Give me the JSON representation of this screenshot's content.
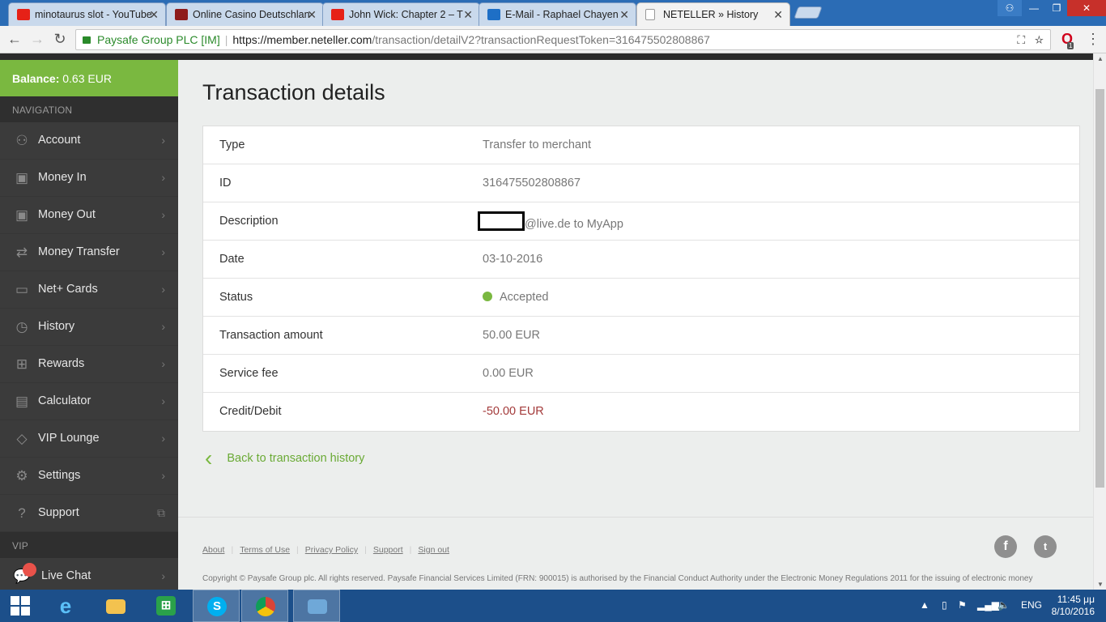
{
  "browser": {
    "tabs": [
      {
        "label": "minotaurus slot - YouTube",
        "favicon": "youtube-icon",
        "color": "#e62117"
      },
      {
        "label": "Online Casino Deutschland",
        "favicon": "casino-d-icon",
        "color": "#8e1b1b"
      },
      {
        "label": "John Wick: Chapter 2 – T",
        "favicon": "youtube-icon",
        "color": "#e62117"
      },
      {
        "label": "E-Mail - Raphael Chayen",
        "favicon": "outlook-icon",
        "color": "#1e6fc6"
      },
      {
        "label": "NETELLER » History",
        "favicon": "page-icon",
        "color": "#ffffff"
      }
    ],
    "secure_label": "Paysafe Group PLC [IM]",
    "url_host": "https://member.neteller.com",
    "url_path": "/transaction/detailV2?transactionRequestToken=316475502808867",
    "extension_badge": "1"
  },
  "sidebar": {
    "balance_label": "Balance:",
    "balance_value": "0.63 EUR",
    "navigation_heading": "NAVIGATION",
    "items": [
      {
        "label": "Account",
        "icon": "user-icon"
      },
      {
        "label": "Money In",
        "icon": "money-in-icon"
      },
      {
        "label": "Money Out",
        "icon": "money-out-icon"
      },
      {
        "label": "Money Transfer",
        "icon": "transfer-icon"
      },
      {
        "label": "Net+ Cards",
        "icon": "card-icon"
      },
      {
        "label": "History",
        "icon": "clock-icon"
      },
      {
        "label": "Rewards",
        "icon": "gift-icon"
      },
      {
        "label": "Calculator",
        "icon": "calculator-icon"
      },
      {
        "label": "VIP Lounge",
        "icon": "diamond-icon"
      },
      {
        "label": "Settings",
        "icon": "gear-icon"
      },
      {
        "label": "Support",
        "icon": "help-icon"
      }
    ],
    "vip_heading": "VIP",
    "live_chat": "Live Chat"
  },
  "main": {
    "title": "Transaction details",
    "rows": [
      {
        "key": "Type",
        "value": "Transfer to merchant"
      },
      {
        "key": "ID",
        "value": "316475502808867"
      },
      {
        "key": "Description",
        "value": "@live.de to MyApp"
      },
      {
        "key": "Date",
        "value": "03-10-2016"
      },
      {
        "key": "Status",
        "value": "Accepted"
      },
      {
        "key": "Transaction amount",
        "value": "50.00 EUR"
      },
      {
        "key": "Service fee",
        "value": "0.00 EUR"
      },
      {
        "key": "Credit/Debit",
        "value": "-50.00 EUR"
      }
    ],
    "back_link": "Back to transaction history"
  },
  "footer": {
    "links": [
      "About",
      "Terms of Use",
      "Privacy Policy",
      "Support",
      "Sign out"
    ],
    "copyright": "Copyright © Paysafe Group plc. All rights reserved. Paysafe Financial Services Limited (FRN: 900015) is authorised by the Financial Conduct Authority under the Electronic Money Regulations 2011 for the issuing of electronic money"
  },
  "taskbar": {
    "language": "ENG",
    "time": "11:45 μμ",
    "date": "8/10/2016"
  },
  "colors": {
    "accent_green": "#7ab840",
    "debit_red": "#a33a3a",
    "sidebar_bg": "#3b3b3b"
  }
}
